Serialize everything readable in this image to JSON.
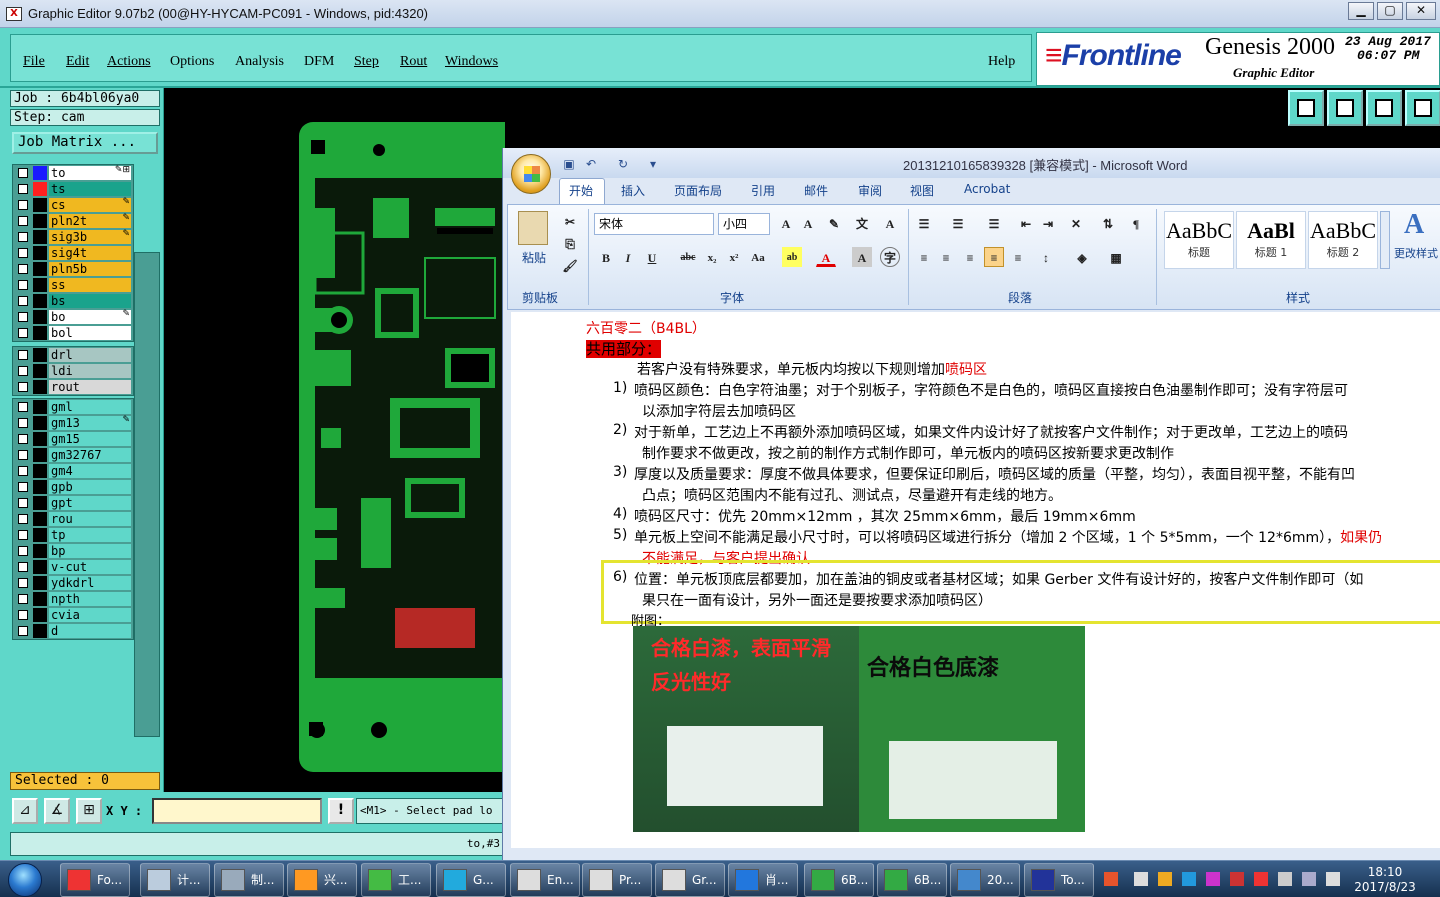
{
  "genesis": {
    "title": "Graphic Editor 9.07b2 (00@HY-HYCAM-PC091 - Windows, pid:4320)",
    "menus": [
      "File",
      "Edit",
      "Actions",
      "Options",
      "Analysis",
      "DFM",
      "Step",
      "Rout",
      "Windows"
    ],
    "help": "Help",
    "brand": {
      "logo": "Frontline",
      "product": "Genesis 2000",
      "subtitle": "Graphic Editor",
      "date_line1": "23  Aug  2017",
      "date_line2": "06:07  PM"
    },
    "job_label": "Job : 6b4bl06ya0",
    "step_label": "Step: cam",
    "job_matrix": "Job Matrix ...",
    "layer_groups": [
      [
        {
          "name": "to",
          "color": "#ffffff",
          "swatch": "#1a1aff",
          "lock": "✎⊞"
        },
        {
          "name": "ts",
          "color": "#1aa38c",
          "swatch": "#ff2020",
          "lock": ""
        },
        {
          "name": "cs",
          "color": "#f0b820",
          "swatch": "#000000",
          "lock": "✎"
        },
        {
          "name": "pln2t",
          "color": "#f0b820",
          "swatch": "#000000",
          "lock": "✎"
        },
        {
          "name": "sig3b",
          "color": "#f0b820",
          "swatch": "#000000",
          "lock": "✎"
        },
        {
          "name": "sig4t",
          "color": "#f0b820",
          "swatch": "#000000",
          "lock": ""
        },
        {
          "name": "pln5b",
          "color": "#f0b820",
          "swatch": "#000000",
          "lock": ""
        },
        {
          "name": "ss",
          "color": "#f0b820",
          "swatch": "#000000",
          "lock": ""
        },
        {
          "name": "bs",
          "color": "#1aa38c",
          "swatch": "#000000",
          "lock": ""
        },
        {
          "name": "bo",
          "color": "#ffffff",
          "swatch": "#000000",
          "lock": "✎"
        },
        {
          "name": "bol",
          "color": "#ffffff",
          "swatch": "#000000",
          "lock": ""
        }
      ],
      [
        {
          "name": "drl",
          "color": "#a7c6c2",
          "swatch": "#000000",
          "lock": ""
        },
        {
          "name": "ldi",
          "color": "#a7c6c2",
          "swatch": "#000000",
          "lock": ""
        },
        {
          "name": "rout",
          "color": "#d8d8d8",
          "swatch": "#000000",
          "lock": ""
        }
      ],
      [
        {
          "name": "gml",
          "color": "#5fd7c9",
          "swatch": "#000000",
          "lock": ""
        },
        {
          "name": "gm13",
          "color": "#5fd7c9",
          "swatch": "#000000",
          "lock": "✎"
        },
        {
          "name": "gm15",
          "color": "#5fd7c9",
          "swatch": "#000000",
          "lock": ""
        },
        {
          "name": "gm32767",
          "color": "#5fd7c9",
          "swatch": "#000000",
          "lock": ""
        },
        {
          "name": "gm4",
          "color": "#5fd7c9",
          "swatch": "#000000",
          "lock": ""
        },
        {
          "name": "gpb",
          "color": "#5fd7c9",
          "swatch": "#000000",
          "lock": ""
        },
        {
          "name": "gpt",
          "color": "#5fd7c9",
          "swatch": "#000000",
          "lock": ""
        },
        {
          "name": "rou",
          "color": "#5fd7c9",
          "swatch": "#000000",
          "lock": ""
        },
        {
          "name": "tp",
          "color": "#5fd7c9",
          "swatch": "#000000",
          "lock": ""
        },
        {
          "name": "bp",
          "color": "#5fd7c9",
          "swatch": "#000000",
          "lock": ""
        },
        {
          "name": "v-cut",
          "color": "#5fd7c9",
          "swatch": "#000000",
          "lock": ""
        },
        {
          "name": "ydkdrl",
          "color": "#5fd7c9",
          "swatch": "#000000",
          "lock": ""
        },
        {
          "name": "npth",
          "color": "#5fd7c9",
          "swatch": "#000000",
          "lock": ""
        },
        {
          "name": "cvia",
          "color": "#5fd7c9",
          "swatch": "#000000",
          "lock": ""
        },
        {
          "name": "d",
          "color": "#5fd7c9",
          "swatch": "#000000",
          "lock": ""
        }
      ]
    ],
    "selected": "Selected : 0",
    "xy_label": "X Y :",
    "xy_value": "",
    "prompt": "<M1> - Select pad lo",
    "coord": "to,#3"
  },
  "word": {
    "title": "20131210165839328 [兼容模式] - Microsoft Word",
    "tabs": [
      "开始",
      "插入",
      "页面布局",
      "引用",
      "邮件",
      "审阅",
      "视图",
      "Acrobat"
    ],
    "paste_label": "粘贴",
    "font_name": "宋体",
    "font_size": "小四",
    "groups": [
      "剪贴板",
      "字体",
      "段落",
      "样式"
    ],
    "styles": [
      {
        "sample": "AaBbC",
        "name": "标题"
      },
      {
        "sample": "AaBl",
        "name": "标题 1"
      },
      {
        "sample": "AaBbC",
        "name": "标题 2"
      }
    ],
    "change_styles": "更改样式",
    "doc": {
      "heading1": "六百零二（B4BL）",
      "heading2": "共用部分：",
      "intro_pre": "若客户没有特殊要求，单元板内均按以下规则增加",
      "intro_red": "喷码区",
      "items": [
        {
          "n": "1)",
          "l1": "喷码区颜色：白色字符油墨；对于个别板子，字符颜色不是白色的，喷码区直接按白色油墨制作即可；没有字符层可",
          "l2": "以添加字符层去加喷码区"
        },
        {
          "n": "2)",
          "l1": "对于新单，工艺边上不再额外添加喷码区域，如果文件内设计好了就按客户文件制作；对于更改单，工艺边上的喷码",
          "l2": "制作要求不做更改，按之前的制作方式制作即可，单元板内的喷码区按新要求更改制作"
        },
        {
          "n": "3)",
          "l1": "厚度以及质量要求：厚度不做具体要求，但要保证印刷后，喷码区域的质量（平整，均匀），表面目视平整，不能有凹",
          "l2": "凸点；喷码区范围内不能有过孔、测试点，尽量避开有走线的地方。"
        },
        {
          "n": "4)",
          "l1": "喷码区尺寸：优先 20mm×12mm ，其次 25mm×6mm，最后 19mm×6mm",
          "l2": ""
        },
        {
          "n": "5)",
          "l1": "单元板上空间不能满足最小尺寸时，可以将喷码区域进行拆分（增加 2 个区域，1 个 5*5mm，一个 12*6mm），",
          "l1_red": "如果仍",
          "l2": "不能满足，与客户提出确认"
        },
        {
          "n": "6)",
          "l1": "位置：单元板顶底层都要加，加在盖油的铜皮或者基材区域；如果 Gerber 文件有设计好的，按客户文件制作即可（如",
          "l2": "果只在一面有设计，另外一面还是要按要求添加喷码区）"
        }
      ],
      "attach": "附图：",
      "photo_left_l1": "合格白漆，表面平滑",
      "photo_left_l2": "反光性好",
      "photo_right": "合格白色底漆"
    }
  },
  "taskbar": {
    "items": [
      "Fo...",
      "计...",
      "制...",
      "兴...",
      "工...",
      "G...",
      "En...",
      "Pr...",
      "Gr...",
      "肖...",
      "6B...",
      "6B...",
      "20...",
      "To..."
    ],
    "time": "18:10",
    "date": "2017/8/23"
  }
}
